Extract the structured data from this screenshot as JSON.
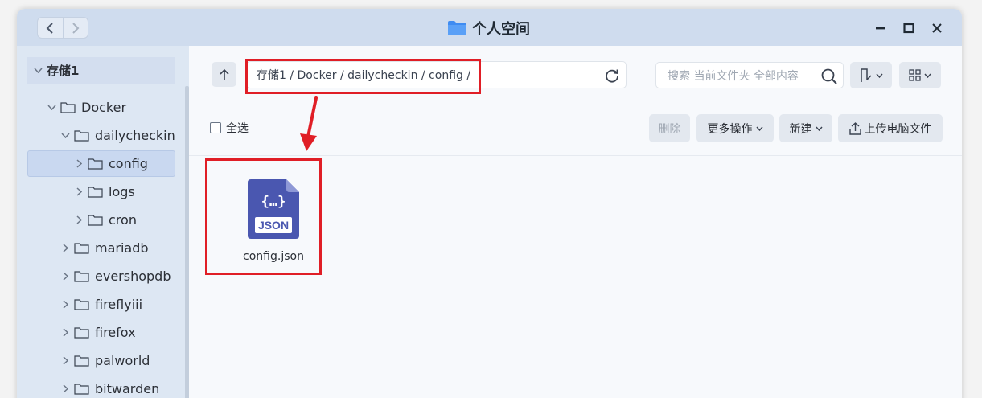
{
  "window": {
    "title": "个人空间",
    "accent": "#3f8cf2"
  },
  "nav": {
    "back_icon": "chevron-left-icon",
    "forward_icon": "chevron-right-icon"
  },
  "sidebar": {
    "root": "存储1",
    "items": [
      {
        "label": "Docker"
      },
      {
        "label": "dailycheckin"
      },
      {
        "label": "config"
      },
      {
        "label": "logs"
      },
      {
        "label": "cron"
      },
      {
        "label": "mariadb"
      },
      {
        "label": "evershopdb"
      },
      {
        "label": "fireflyiii"
      },
      {
        "label": "firefox"
      },
      {
        "label": "palworld"
      },
      {
        "label": "bitwarden"
      }
    ]
  },
  "toolbar": {
    "path": "存储1 / Docker / dailycheckin / config /",
    "search_placeholder": "搜索 当前文件夹 全部内容",
    "select_all": "全选",
    "delete": "删除",
    "more_actions": "更多操作",
    "new": "新建",
    "upload": "上传电脑文件"
  },
  "files": [
    {
      "name": "config.json",
      "icon_text": "JSON",
      "icon_code": "{…}"
    }
  ],
  "annotation": {
    "color": "#e01e26"
  }
}
